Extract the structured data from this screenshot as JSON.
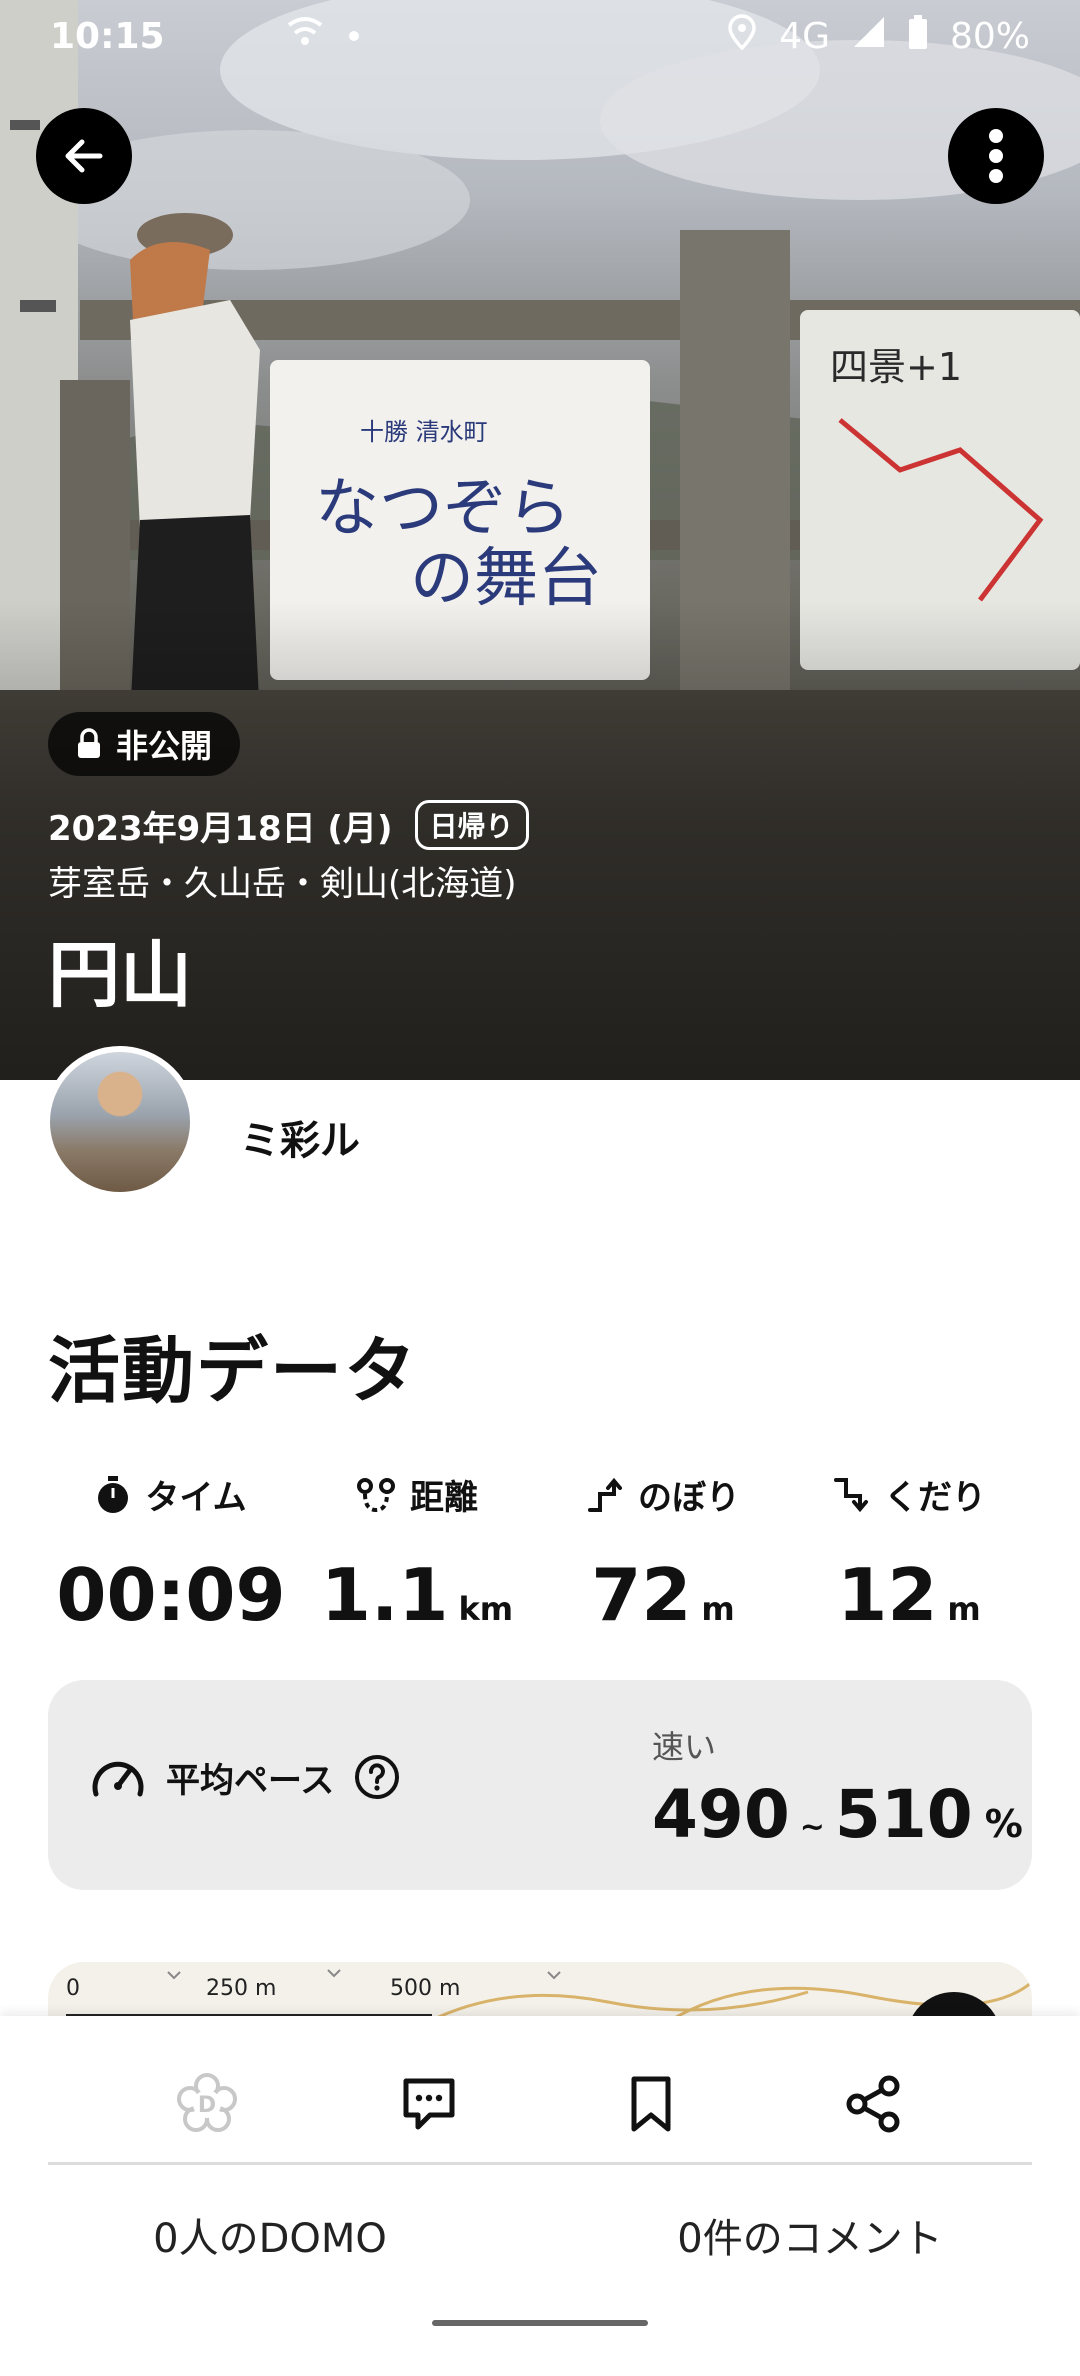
{
  "status_bar": {
    "time": "10:15",
    "network": "4G",
    "battery": "80%"
  },
  "hero": {
    "privacy_label": "非公開",
    "date": "2023年9月18日 (月)",
    "trip_type": "日帰り",
    "area": "芽室岳・久山岳・剣山(北海道)",
    "title": "円山",
    "sign_line1": "十勝 清水町",
    "sign_line2": "なつぞら",
    "sign_line3": "の舞台",
    "map_sign_title": "四景+1"
  },
  "user": {
    "name": "ミ彩ル"
  },
  "activity": {
    "title": "活動データ",
    "stats": [
      {
        "label": "タイム",
        "value": "00:09",
        "unit": ""
      },
      {
        "label": "距離",
        "value": "1.1",
        "unit": "km"
      },
      {
        "label": "のぼり",
        "value": "72",
        "unit": "m"
      },
      {
        "label": "くだり",
        "value": "12",
        "unit": "m"
      }
    ],
    "pace": {
      "label": "平均ペース",
      "speed": "速い",
      "low": "490",
      "tilde": "~",
      "high": "510",
      "unit": "%"
    }
  },
  "map": {
    "scale": [
      "0",
      "250 m",
      "500 m"
    ]
  },
  "bottom": {
    "domo_count": "0人のDOMO",
    "comment_count": "0件のコメント"
  }
}
